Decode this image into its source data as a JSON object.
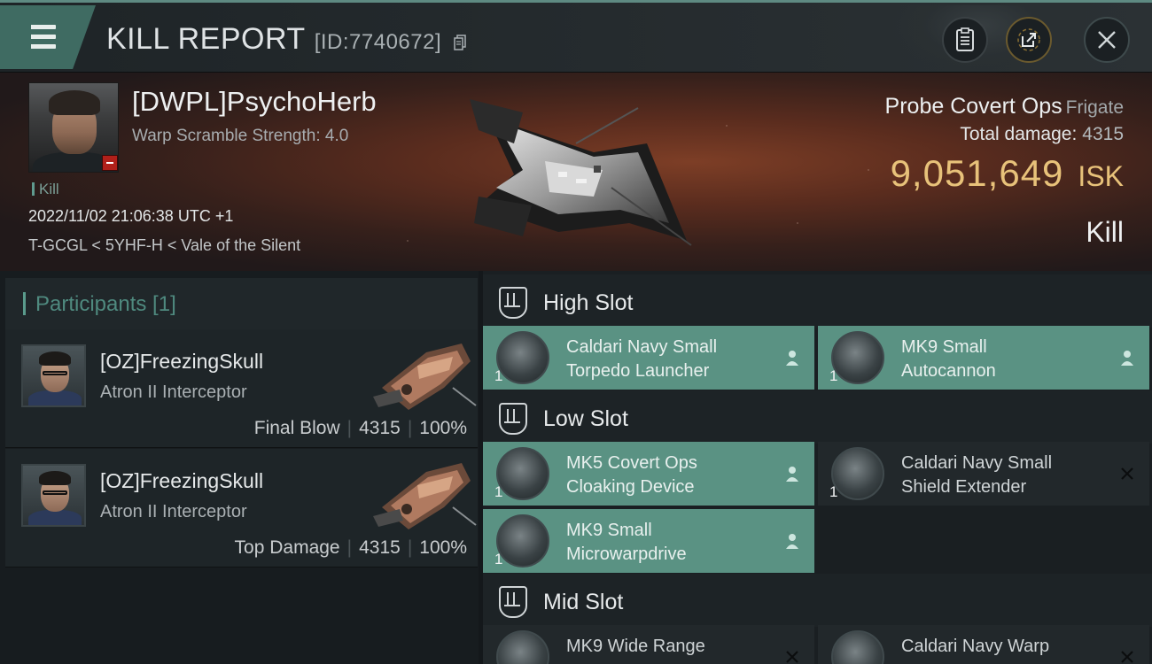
{
  "header": {
    "title": "KILL REPORT",
    "report_id": "[ID:7740672]"
  },
  "victim": {
    "name": "[DWPL]PsychoHerb",
    "warp_scramble": "Warp Scramble Strength: 4.0",
    "kill_tag": "Kill",
    "datetime": "2022/11/02 21:06:38 UTC +1",
    "location": "T-GCGL < 5YHF-H < Vale of the Silent",
    "ship_name": "Probe Covert Ops",
    "ship_class": "Frigate",
    "total_damage_label": "Total damage:",
    "total_damage_value": "4315",
    "isk_value": "9,051,649",
    "isk_unit": "ISK",
    "result_label": "Kill"
  },
  "participants": {
    "title": "Participants [1]",
    "rows": [
      {
        "name": "[OZ]FreezingSkull",
        "ship": "Atron II Interceptor",
        "role": "Final Blow",
        "damage": "4315",
        "percent": "100%"
      },
      {
        "name": "[OZ]FreezingSkull",
        "ship": "Atron II Interceptor",
        "role": "Top Damage",
        "damage": "4315",
        "percent": "100%"
      }
    ]
  },
  "fittings": {
    "high": {
      "title": "High Slot",
      "modules": [
        {
          "line1": "Caldari Navy Small",
          "line2": "Torpedo Launcher",
          "qty": "1"
        },
        {
          "line1": "MK9 Small",
          "line2": "Autocannon",
          "qty": "1"
        }
      ]
    },
    "low": {
      "title": "Low Slot",
      "modules": [
        {
          "line1": "MK5 Covert Ops",
          "line2": "Cloaking Device",
          "qty": "1"
        },
        {
          "line1": "Caldari Navy Small",
          "line2": "Shield Extender",
          "qty": "1"
        },
        {
          "line1": "MK9 Small",
          "line2": "Microwarpdrive",
          "qty": "1"
        }
      ]
    },
    "mid": {
      "title": "Mid Slot",
      "modules": [
        {
          "line1": "MK9 Wide Range",
          "line2": ""
        },
        {
          "line1": "Caldari Navy Warp",
          "line2": ""
        }
      ]
    }
  },
  "colors": {
    "accent": "#5a9283",
    "isk": "#e8c27a",
    "alert": "#b0201a"
  },
  "icons": {
    "menu": "hamburger-icon",
    "copy": "copy-icon",
    "report": "clipboard-icon",
    "share": "share-icon",
    "close": "close-icon",
    "dropped": "person-icon",
    "destroyed": "x-icon"
  }
}
